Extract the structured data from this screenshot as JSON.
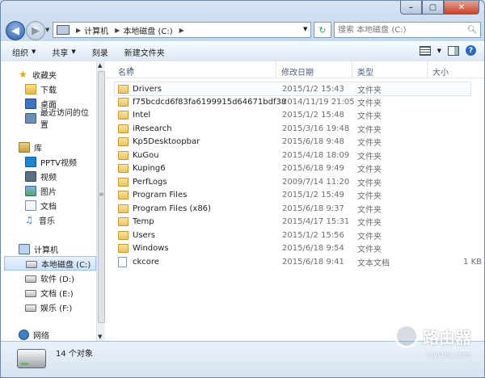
{
  "window": {
    "controls": {
      "minimize": "–",
      "maximize": "▢",
      "close": "✕"
    }
  },
  "address": {
    "crumbs": [
      "计算机",
      "本地磁盘 (C:)"
    ],
    "search_placeholder": "搜索 本地磁盘 (C:)"
  },
  "toolbar": {
    "organize": "组织",
    "share": "共享",
    "burn": "刻录",
    "new_folder": "新建文件夹"
  },
  "nav": {
    "favorites": {
      "label": "收藏夹",
      "items": [
        "下载",
        "桌面",
        "最近访问的位置"
      ]
    },
    "libraries": {
      "label": "库",
      "items": [
        "PPTV视频",
        "视频",
        "图片",
        "文档",
        "音乐"
      ]
    },
    "computer": {
      "label": "计算机",
      "items": [
        "本地磁盘 (C:)",
        "软件 (D:)",
        "文档 (E:)",
        "娱乐 (F:)"
      ]
    },
    "network": {
      "label": "网络"
    }
  },
  "columns": {
    "name": "名称",
    "date": "修改日期",
    "type": "类型",
    "size": "大小"
  },
  "files": [
    {
      "name": "Drivers",
      "date": "2015/1/2 15:43",
      "type": "文件夹",
      "size": "",
      "kind": "folder"
    },
    {
      "name": "f75bcdcd6f83fa6199915d64671bdf38",
      "date": "2014/11/19 21:05",
      "type": "文件夹",
      "size": "",
      "kind": "folder-lock"
    },
    {
      "name": "Intel",
      "date": "2015/1/2 15:48",
      "type": "文件夹",
      "size": "",
      "kind": "folder"
    },
    {
      "name": "iResearch",
      "date": "2015/3/16 19:48",
      "type": "文件夹",
      "size": "",
      "kind": "folder"
    },
    {
      "name": "Kp5Desktoopbar",
      "date": "2015/6/18 9:48",
      "type": "文件夹",
      "size": "",
      "kind": "folder"
    },
    {
      "name": "KuGou",
      "date": "2015/4/18 18:09",
      "type": "文件夹",
      "size": "",
      "kind": "folder"
    },
    {
      "name": "Kuping6",
      "date": "2015/6/18 9:49",
      "type": "文件夹",
      "size": "",
      "kind": "folder"
    },
    {
      "name": "PerfLogs",
      "date": "2009/7/14 11:20",
      "type": "文件夹",
      "size": "",
      "kind": "folder"
    },
    {
      "name": "Program Files",
      "date": "2015/1/2 15:49",
      "type": "文件夹",
      "size": "",
      "kind": "folder"
    },
    {
      "name": "Program Files (x86)",
      "date": "2015/6/18 9:37",
      "type": "文件夹",
      "size": "",
      "kind": "folder"
    },
    {
      "name": "Temp",
      "date": "2015/4/17 15:31",
      "type": "文件夹",
      "size": "",
      "kind": "folder"
    },
    {
      "name": "Users",
      "date": "2015/1/2 15:56",
      "type": "文件夹",
      "size": "",
      "kind": "folder"
    },
    {
      "name": "Windows",
      "date": "2015/6/18 9:54",
      "type": "文件夹",
      "size": "",
      "kind": "folder"
    },
    {
      "name": "ckcore",
      "date": "2015/6/18 9:41",
      "type": "文本文档",
      "size": "1 KB",
      "kind": "text"
    }
  ],
  "status": {
    "count": "14 个对象"
  },
  "watermark": {
    "text": "路由器",
    "sub": "luyouqi.com"
  }
}
